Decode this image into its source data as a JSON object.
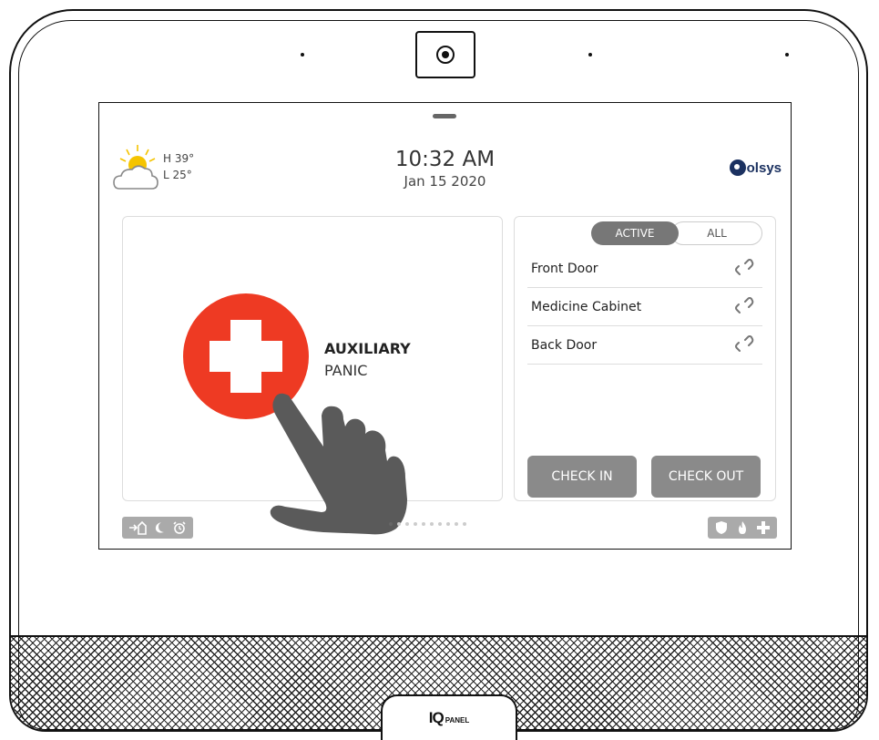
{
  "weather": {
    "high": "H 39°",
    "low": "L 25°"
  },
  "clock": {
    "time": "10:32 AM",
    "date": "Jan 15 2020"
  },
  "brand": {
    "name": "olsys"
  },
  "panic": {
    "title": "AUXILIARY",
    "subtitle": "PANIC"
  },
  "sensors": {
    "tabs": {
      "active": "ACTIVE",
      "all": "ALL"
    },
    "items": [
      {
        "name": "Front Door"
      },
      {
        "name": "Medicine Cabinet"
      },
      {
        "name": "Back Door"
      }
    ],
    "check_in_label": "CHECK IN",
    "check_out_label": "CHECK OUT"
  },
  "pages": {
    "count": 10,
    "current": 1
  },
  "device_logo": {
    "iq": "IQ",
    "panel": "PANEL"
  },
  "colors": {
    "panic_red": "#ee3a23",
    "brand_blue": "#1b3160",
    "button_grey": "#8a8a8a"
  }
}
